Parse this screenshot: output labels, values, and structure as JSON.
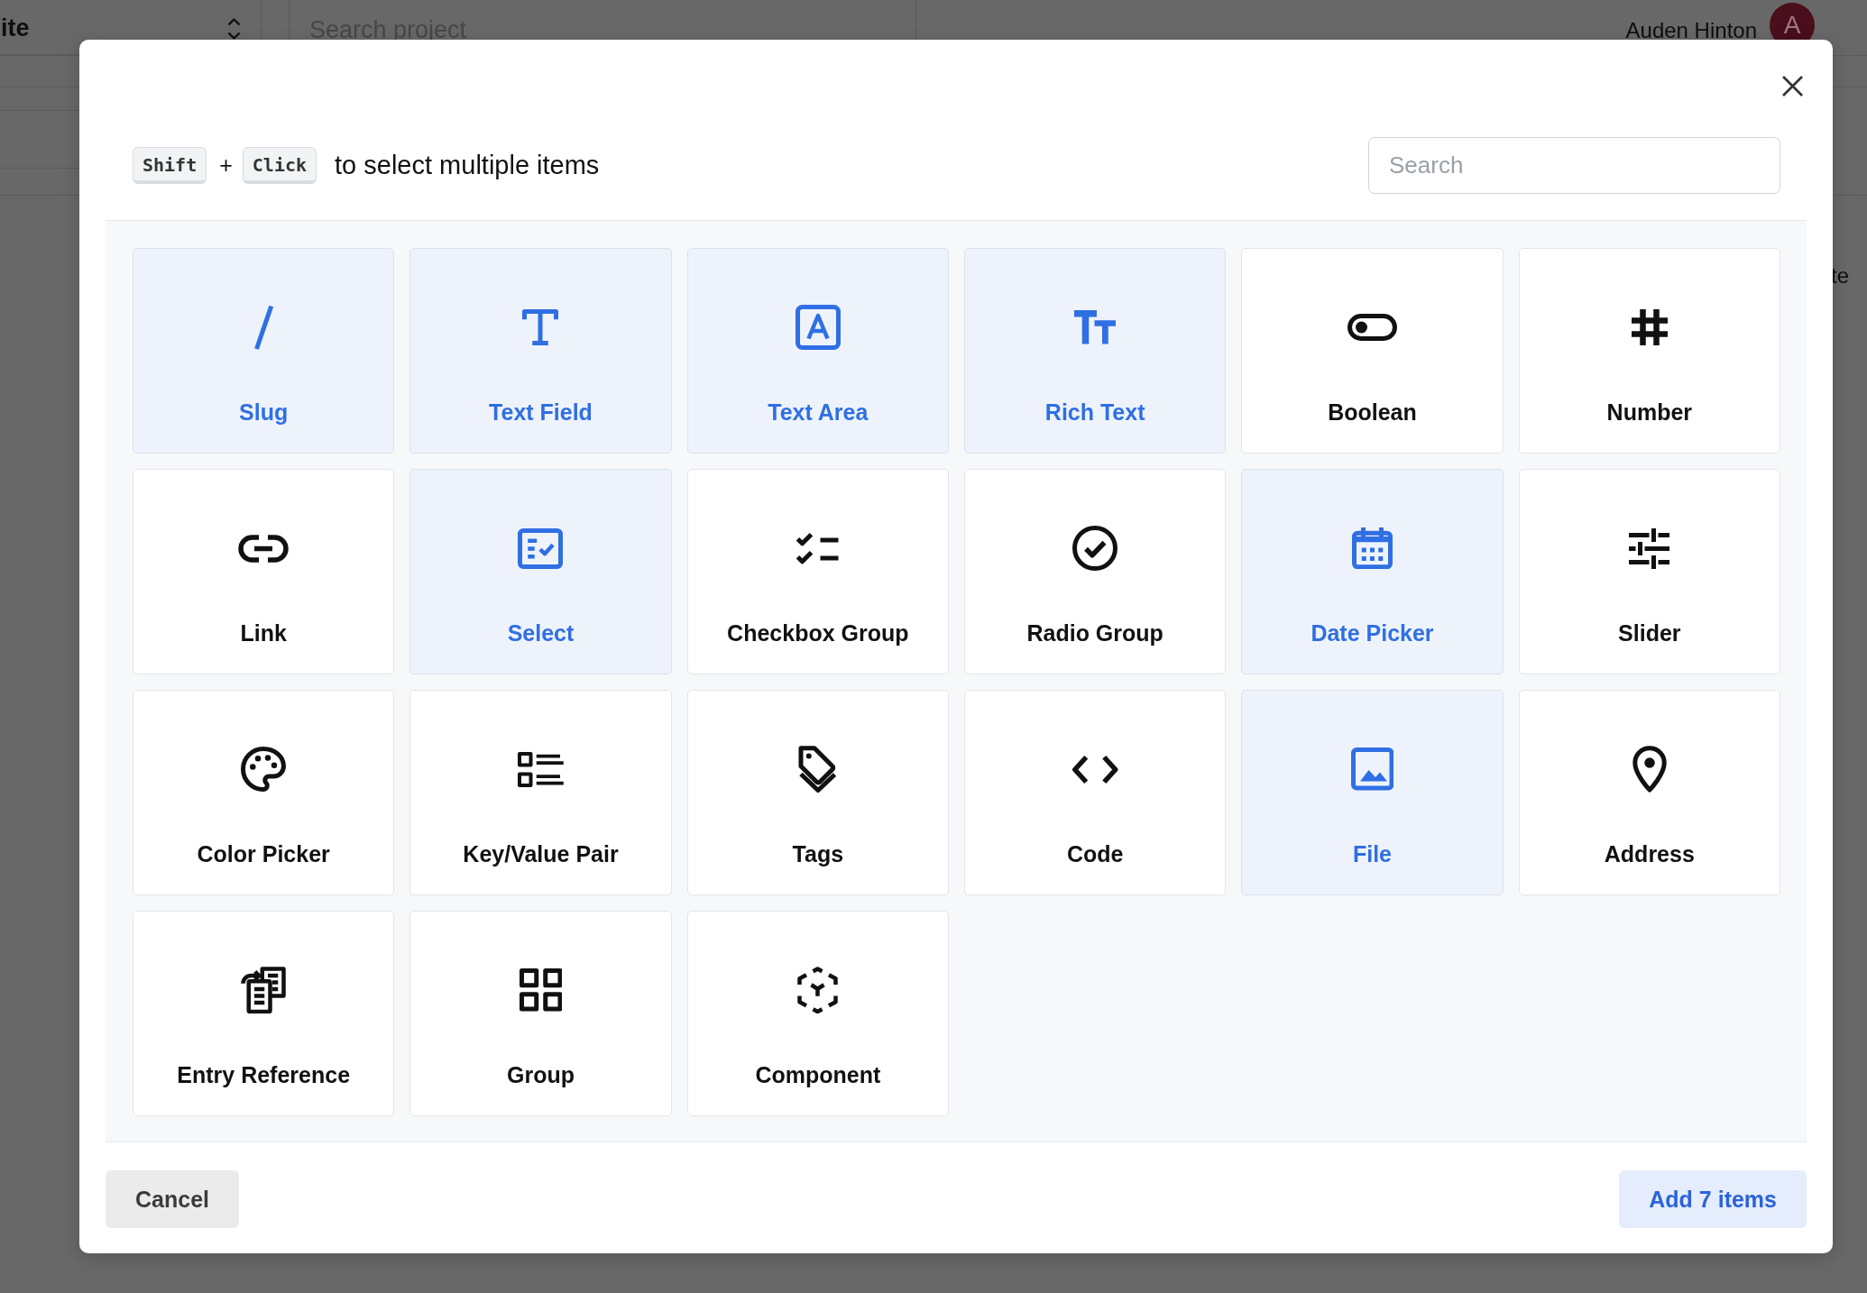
{
  "background": {
    "project_select": {
      "value": "ite"
    },
    "search": {
      "placeholder": "Search project"
    },
    "user": {
      "name": "Auden Hinton",
      "avatar_initial": "A"
    },
    "side_text": "te"
  },
  "dialog": {
    "hint": {
      "keys": [
        "Shift",
        "Click"
      ],
      "joiner": "+",
      "text": "to select multiple items"
    },
    "search": {
      "placeholder": "Search"
    },
    "field_types": [
      {
        "label": "Slug",
        "kind": "slug",
        "selected": true
      },
      {
        "label": "Text Field",
        "kind": "textfield",
        "selected": true
      },
      {
        "label": "Text Area",
        "kind": "textarea",
        "selected": true
      },
      {
        "label": "Rich Text",
        "kind": "richtext",
        "selected": true
      },
      {
        "label": "Boolean",
        "kind": "boolean",
        "selected": false
      },
      {
        "label": "Number",
        "kind": "number",
        "selected": false
      },
      {
        "label": "Link",
        "kind": "link",
        "selected": false
      },
      {
        "label": "Select",
        "kind": "select",
        "selected": true
      },
      {
        "label": "Checkbox Group",
        "kind": "checkbox",
        "selected": false
      },
      {
        "label": "Radio Group",
        "kind": "radio",
        "selected": false
      },
      {
        "label": "Date Picker",
        "kind": "date",
        "selected": true
      },
      {
        "label": "Slider",
        "kind": "slider",
        "selected": false
      },
      {
        "label": "Color Picker",
        "kind": "color",
        "selected": false
      },
      {
        "label": "Key/Value Pair",
        "kind": "keyvalue",
        "selected": false
      },
      {
        "label": "Tags",
        "kind": "tags",
        "selected": false
      },
      {
        "label": "Code",
        "kind": "code",
        "selected": false
      },
      {
        "label": "File",
        "kind": "file",
        "selected": true
      },
      {
        "label": "Address",
        "kind": "address",
        "selected": false
      },
      {
        "label": "Entry Reference",
        "kind": "reference",
        "selected": false
      },
      {
        "label": "Group",
        "kind": "group",
        "selected": false
      },
      {
        "label": "Component",
        "kind": "component",
        "selected": false
      }
    ],
    "buttons": [
      {
        "label": "Cancel",
        "kind": "secondary"
      },
      {
        "label": "Add 7 items",
        "kind": "primary"
      }
    ]
  }
}
